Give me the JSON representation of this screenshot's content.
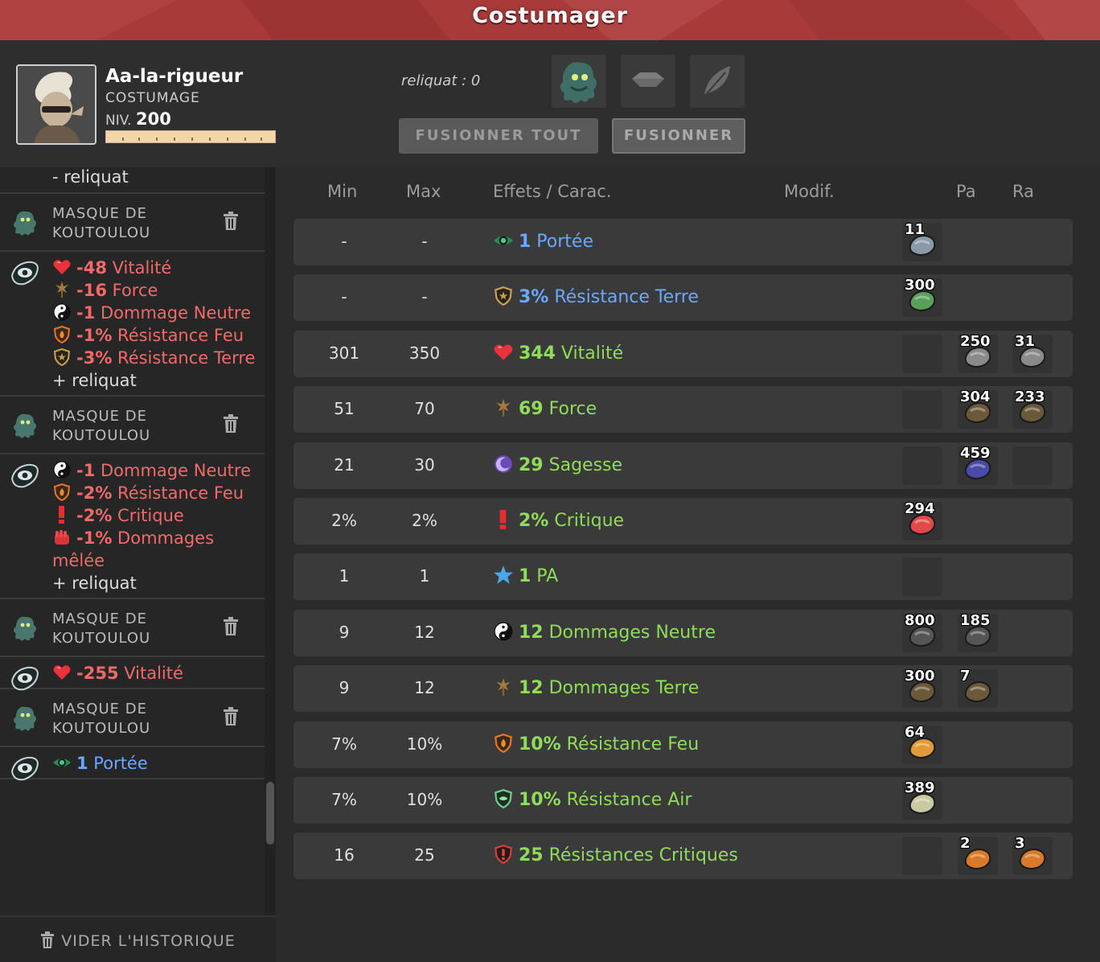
{
  "window": {
    "title": "Costumager"
  },
  "character": {
    "name": "Aa-la-rigueur",
    "mode": "COSTUMAGE",
    "level_label": "NIV.",
    "level": "200"
  },
  "header": {
    "reliquat_label": "reliquat : 0",
    "merge_all_label": "FUSIONNER TOUT",
    "merge_label": "FUSIONNER"
  },
  "history": {
    "top_partial": "- reliquat",
    "item_name": "MASQUE DE\nKOUTOULOU",
    "clear_label": "VIDER L'HISTORIQUE",
    "effects": [
      [
        {
          "icon": "heart-icon",
          "val": "-48",
          "text": " Vitalité"
        },
        {
          "icon": "force-icon",
          "val": "-16",
          "text": " Force"
        },
        {
          "icon": "neutral-icon",
          "val": "-1",
          "text": " Dommage Neutre"
        },
        {
          "icon": "fire-res-icon",
          "val": "-1%",
          "text": " Résistance Feu"
        },
        {
          "icon": "earth-res-icon",
          "val": "-3%",
          "text": " Résistance Terre"
        }
      ],
      [
        {
          "icon": "neutral-icon",
          "val": "-1",
          "text": " Dommage Neutre"
        },
        {
          "icon": "fire-res-icon",
          "val": "-2%",
          "text": " Résistance Feu"
        },
        {
          "icon": "crit-icon",
          "val": "-2%",
          "text": " Critique"
        },
        {
          "icon": "melee-icon",
          "val": "-1%",
          "text": " Dommages mêlée"
        }
      ],
      [
        {
          "icon": "heart-icon",
          "val": "-255",
          "text": " Vitalité"
        }
      ],
      [
        {
          "icon": "eye-icon",
          "val": "1",
          "text": " Portée",
          "blue": true
        }
      ]
    ],
    "reliquat_plus": "+ reliquat"
  },
  "table": {
    "headers": {
      "min": "Min",
      "max": "Max",
      "effects": "Effets / Carac.",
      "modif": "Modif.",
      "pa": "Pa",
      "ra": "Ra"
    },
    "rows": [
      {
        "min": "-",
        "max": "-",
        "icon": "eye-icon",
        "val": "1",
        "label": " Portée",
        "color": "blue",
        "ba": "11",
        "pa": null,
        "ra": null
      },
      {
        "min": "-",
        "max": "-",
        "icon": "earth-res-icon",
        "val": "3%",
        "label": " Résistance Terre",
        "color": "blue",
        "ba": "300",
        "pa": null,
        "ra": null
      },
      {
        "min": "301",
        "max": "350",
        "icon": "heart-icon",
        "val": "344",
        "label": " Vitalité",
        "color": "green",
        "ba": "",
        "pa": "250",
        "ra": "31"
      },
      {
        "min": "51",
        "max": "70",
        "icon": "force-icon",
        "val": "69",
        "label": " Force",
        "color": "green",
        "ba": "",
        "pa": "304",
        "ra": "233"
      },
      {
        "min": "21",
        "max": "30",
        "icon": "wisdom-icon",
        "val": "29",
        "label": " Sagesse",
        "color": "green",
        "ba": "",
        "pa": "459",
        "ra": ""
      },
      {
        "min": "2%",
        "max": "2%",
        "icon": "crit-icon",
        "val": "2%",
        "label": " Critique",
        "color": "green",
        "ba": "294",
        "pa": null,
        "ra": null
      },
      {
        "min": "1",
        "max": "1",
        "icon": "star-icon",
        "val": "1",
        "label": " PA",
        "color": "green",
        "ba": "",
        "pa": null,
        "ra": null
      },
      {
        "min": "9",
        "max": "12",
        "icon": "neutral-icon",
        "val": "12",
        "label": " Dommages Neutre",
        "color": "green",
        "ba": "800",
        "pa": "185",
        "ra": null
      },
      {
        "min": "9",
        "max": "12",
        "icon": "force-icon",
        "val": "12",
        "label": " Dommages Terre",
        "color": "green",
        "ba": "300",
        "pa": "7",
        "ra": null
      },
      {
        "min": "7%",
        "max": "10%",
        "icon": "fire-res-icon",
        "val": "10%",
        "label": " Résistance Feu",
        "color": "green",
        "ba": "64",
        "pa": null,
        "ra": null
      },
      {
        "min": "7%",
        "max": "10%",
        "icon": "air-res-icon",
        "val": "10%",
        "label": " Résistance Air",
        "color": "green",
        "ba": "389",
        "pa": null,
        "ra": null
      },
      {
        "min": "16",
        "max": "25",
        "icon": "crit-res-icon",
        "val": "25",
        "label": " Résistances Critiques",
        "color": "green",
        "ba": "",
        "pa": "2",
        "ra": "3"
      }
    ]
  },
  "colors": {
    "title_bar": "#a83a3a",
    "green": "#8fdc5a",
    "blue": "#6aa8ff",
    "red": "#f06a6a"
  }
}
